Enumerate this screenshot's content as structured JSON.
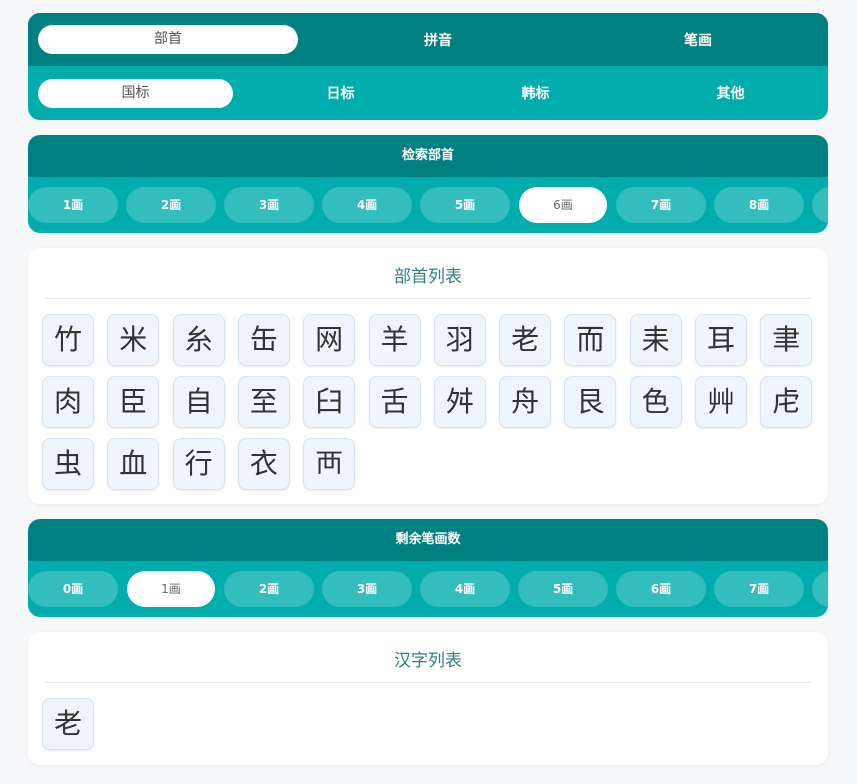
{
  "mode_tabs": [
    {
      "label": "部首",
      "active": true
    },
    {
      "label": "拼音",
      "active": false
    },
    {
      "label": "笔画",
      "active": false
    }
  ],
  "standard_tabs": [
    {
      "label": "国标",
      "active": true
    },
    {
      "label": "日标",
      "active": false
    },
    {
      "label": "韩标",
      "active": false
    },
    {
      "label": "其他",
      "active": false
    }
  ],
  "radical_search": {
    "title": "检索部首",
    "chips": [
      "1画",
      "2画",
      "3画",
      "4画",
      "5画",
      "6画",
      "7画",
      "8画"
    ],
    "selected": "6画"
  },
  "radical_list": {
    "title": "部首列表",
    "items": [
      "竹",
      "米",
      "糸",
      "缶",
      "网",
      "羊",
      "羽",
      "老",
      "而",
      "耒",
      "耳",
      "聿",
      "肉",
      "臣",
      "自",
      "至",
      "臼",
      "舌",
      "舛",
      "舟",
      "艮",
      "色",
      "艸",
      "虍",
      "虫",
      "血",
      "行",
      "衣",
      "襾"
    ]
  },
  "remaining_strokes": {
    "title": "剩余笔画数",
    "chips": [
      "0画",
      "1画",
      "2画",
      "3画",
      "4画",
      "5画",
      "6画",
      "7画"
    ],
    "selected": "1画"
  },
  "char_list": {
    "title": "汉字列表",
    "items": [
      "老"
    ]
  },
  "colors": {
    "teal_dark": "#008080",
    "teal": "#00acac",
    "chip": "#33bdbd",
    "cell_bg": "#eef5fd"
  }
}
